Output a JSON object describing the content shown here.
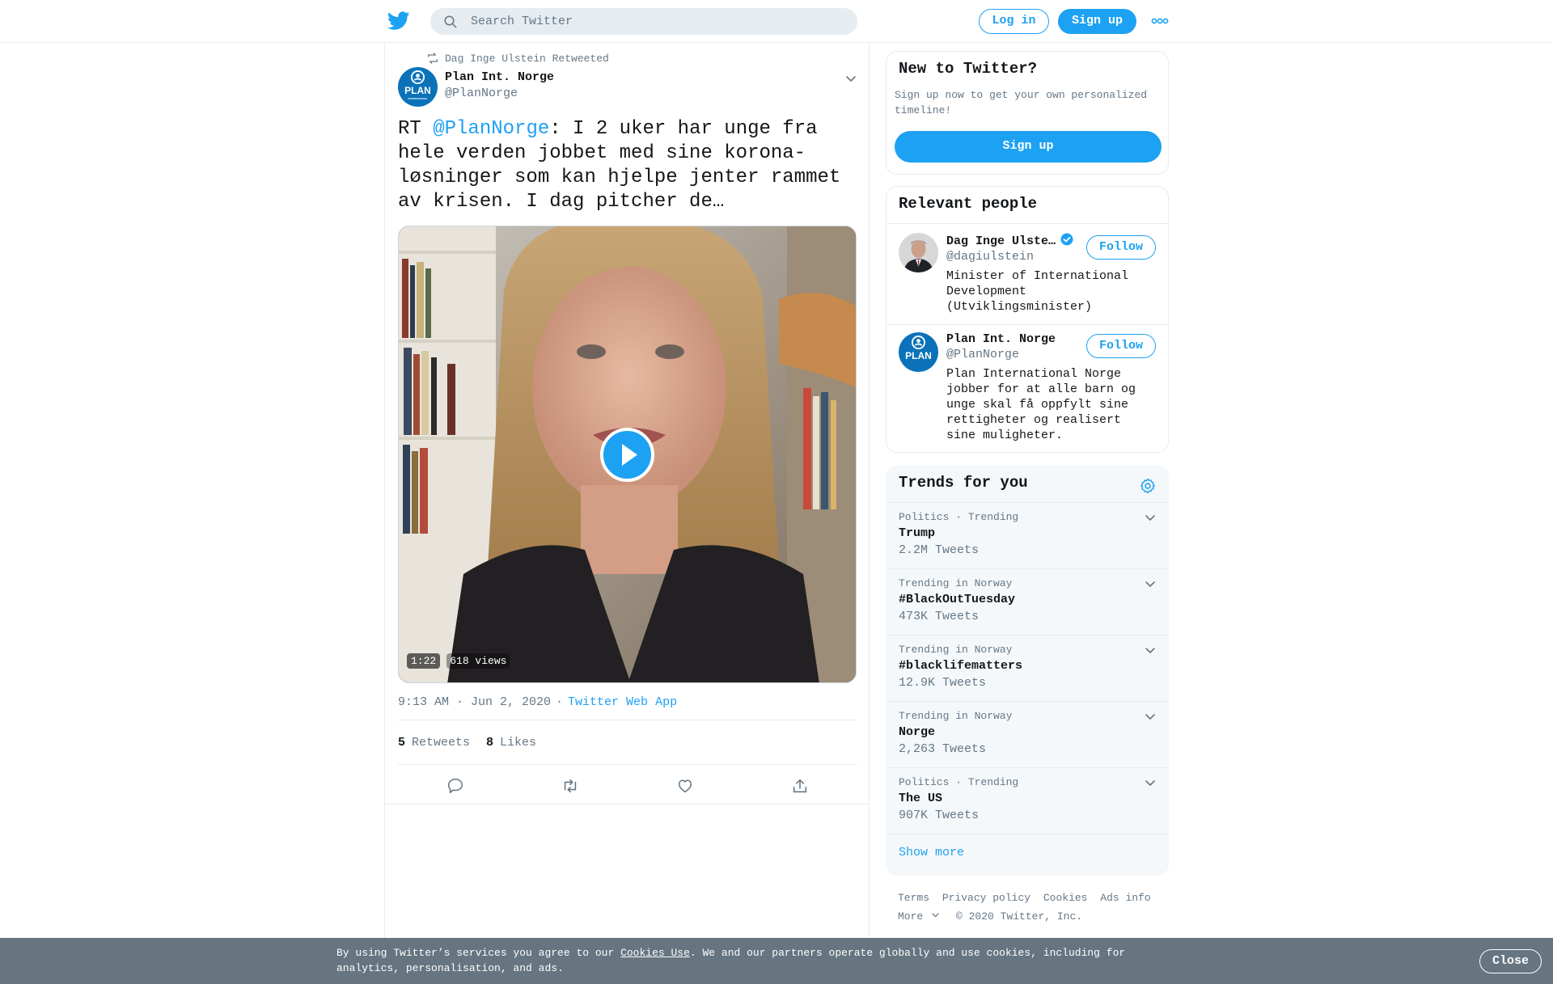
{
  "header": {
    "search_placeholder": "Search Twitter",
    "login_label": "Log in",
    "signup_label": "Sign up",
    "logo_icon": "twitter-bird-icon",
    "more_icon": "more-dots-icon"
  },
  "tweet": {
    "retweeted_by": "Dag Inge Ulstein Retweeted",
    "author_name": "Plan Int. Norge",
    "author_handle": "@PlanNorge",
    "text_prefix": "RT ",
    "text_mention": "@PlanNorge",
    "text_body": ": I 2 uker har unge fra hele verden jobbet med sine korona-løsninger som kan hjelpe jenter rammet av krisen. I dag pitcher de…",
    "video_duration": "1:22",
    "video_views": "618 views",
    "timestamp": "9:13 AM · Jun 2, 2020",
    "separator": "·",
    "source": "Twitter Web App",
    "retweets_count": "5",
    "retweets_label": "Retweets",
    "likes_count": "8",
    "likes_label": "Likes",
    "avatar_text": "PLAN",
    "avatar_subtext": "INTERNATIONAL"
  },
  "sidebar": {
    "new_title": "New to Twitter?",
    "new_desc": "Sign up now to get your own personalized timeline!",
    "new_signup": "Sign up",
    "people_title": "Relevant people",
    "people": [
      {
        "name": "Dag Inge Ulste…",
        "handle": "@dagiulstein",
        "bio": "Minister of International Development (Utviklingsminister)",
        "follow": "Follow",
        "verified": true
      },
      {
        "name": "Plan Int. Norge",
        "handle": "@PlanNorge",
        "bio": "Plan International Norge jobber for at alle barn og unge skal få oppfylt sine rettigheter og realisert sine muligheter.",
        "follow": "Follow",
        "verified": false
      }
    ],
    "trends_title": "Trends for you",
    "trends": [
      {
        "context": "Politics · Trending",
        "name": "Trump",
        "count": "2.2M Tweets"
      },
      {
        "context": "Trending in Norway",
        "name": "#BlackOutTuesday",
        "count": "473K Tweets"
      },
      {
        "context": "Trending in Norway",
        "name": "#blacklifematters",
        "count": "12.9K Tweets"
      },
      {
        "context": "Trending in Norway",
        "name": "Norge",
        "count": "2,263 Tweets"
      },
      {
        "context": "Politics · Trending",
        "name": "The US",
        "count": "907K Tweets"
      }
    ],
    "show_more": "Show more"
  },
  "footer": {
    "links": [
      "Terms",
      "Privacy policy",
      "Cookies",
      "Ads info"
    ],
    "more": "More",
    "copyright": "© 2020 Twitter, Inc."
  },
  "cookie_bar": {
    "text_before": "By using Twitter’s services you agree to our ",
    "link": "Cookies Use",
    "text_after": ". We and our partners operate globally and use cookies, including for analytics, personalisation, and ads.",
    "close": "Close"
  },
  "colors": {
    "accent": "#1da1f2",
    "text_primary": "#14171a",
    "text_secondary": "#657786",
    "border": "#e6ecf0",
    "cookie_bg": "#66757f"
  }
}
